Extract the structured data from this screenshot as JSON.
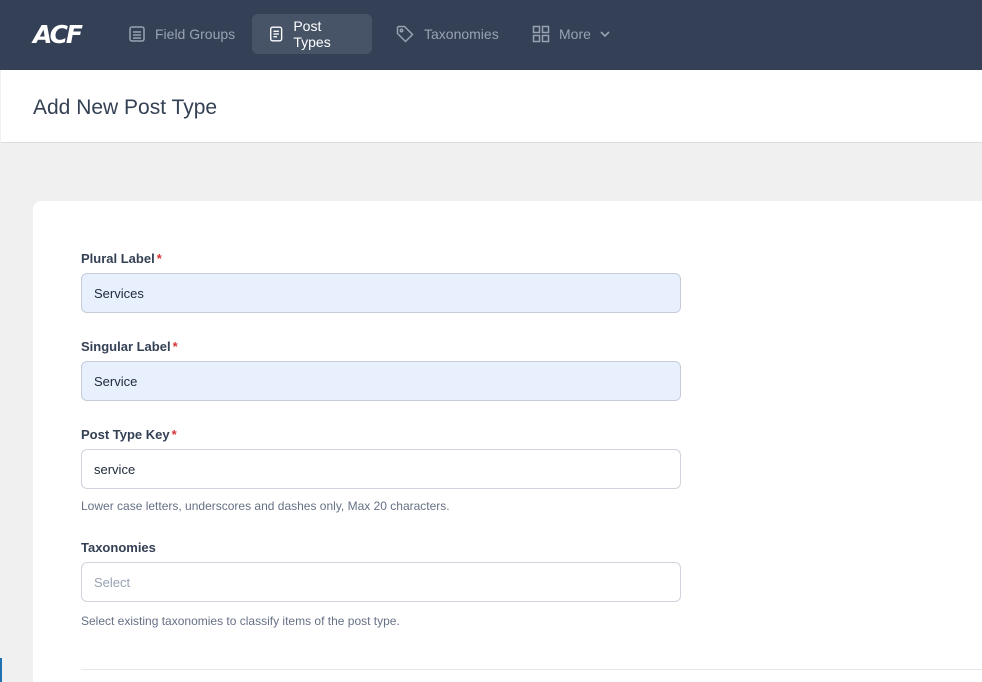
{
  "app": {
    "logo": "ACF"
  },
  "nav": {
    "field_groups": "Field Groups",
    "post_types": "Post Types",
    "taxonomies": "Taxonomies",
    "more": "More"
  },
  "page": {
    "title": "Add New Post Type"
  },
  "form": {
    "plural_label": {
      "label": "Plural Label",
      "required": "*",
      "value": "Services"
    },
    "singular_label": {
      "label": "Singular Label",
      "required": "*",
      "value": "Service"
    },
    "post_type_key": {
      "label": "Post Type Key",
      "required": "*",
      "value": "service",
      "help": "Lower case letters, underscores and dashes only, Max 20 characters."
    },
    "taxonomies": {
      "label": "Taxonomies",
      "placeholder": "Select",
      "help": "Select existing taxonomies to classify items of the post type."
    }
  },
  "colors": {
    "topbar": "#344055",
    "active_nav": "#475467",
    "required": "#d63638",
    "autofill": "#e8f0fe"
  }
}
